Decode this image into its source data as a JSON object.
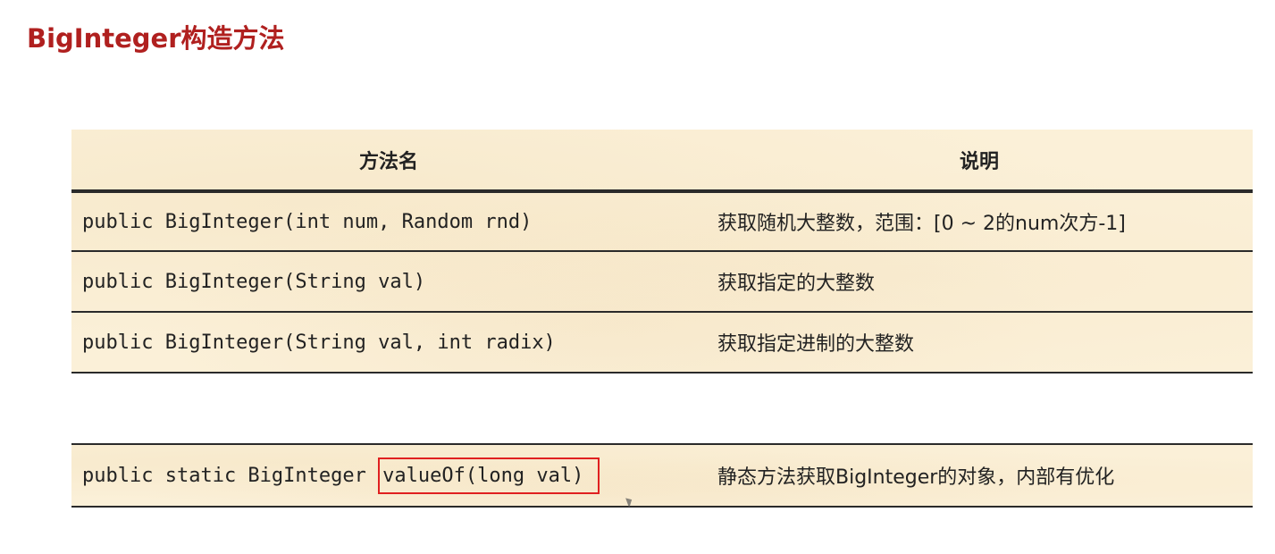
{
  "title": "BigInteger构造方法",
  "table": {
    "headers": {
      "method": "方法名",
      "description": "说明"
    },
    "rows": [
      {
        "method": "public BigInteger(int num, Random rnd)",
        "description": "获取随机大整数，范围：[0 ~ 2的num次方-1]"
      },
      {
        "method": "public BigInteger(String val)",
        "description": "获取指定的大整数"
      },
      {
        "method": "public BigInteger(String val, int radix)",
        "description": "获取指定进制的大整数"
      }
    ]
  },
  "extra_row": {
    "method_prefix": "public static BigInteger ",
    "method_highlight": "valueOf(long val)",
    "description": "静态方法获取BigInteger的对象，内部有优化"
  },
  "colors": {
    "title": "#b0201f",
    "table_bg": "#fbf0d8",
    "highlight_border": "#e02020"
  }
}
